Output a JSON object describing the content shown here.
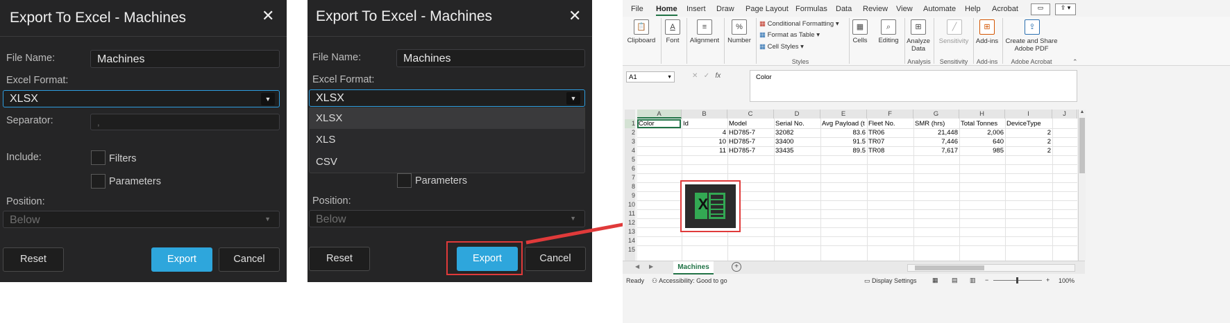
{
  "dialog1": {
    "title": "Export To Excel - Machines",
    "close": "✕",
    "file_name_label": "File Name:",
    "file_name_value": "Machines",
    "excel_format_label": "Excel Format:",
    "excel_format_value": "XLSX",
    "dropdown_arrow": "▼",
    "separator_label": "Separator:",
    "separator_value": ",",
    "include_label": "Include:",
    "filters_label": "Filters",
    "parameters_label": "Parameters",
    "position_label": "Position:",
    "position_value": "Below",
    "reset_label": "Reset",
    "export_label": "Export",
    "cancel_label": "Cancel"
  },
  "dialog2": {
    "title": "Export To Excel - Machines",
    "close": "✕",
    "file_name_label": "File Name:",
    "file_name_value": "Machines",
    "excel_format_label": "Excel Format:",
    "excel_format_value": "XLSX",
    "dropdown_arrow": "▼",
    "format_options": [
      "XLSX",
      "XLS",
      "CSV"
    ],
    "parameters_label": "Parameters",
    "position_label": "Position:",
    "position_value": "Below",
    "reset_label": "Reset",
    "export_label": "Export",
    "cancel_label": "Cancel",
    "highlight_color": "#e03a3a"
  },
  "excel": {
    "menu_tabs": [
      "File",
      "Home",
      "Insert",
      "Draw",
      "Page Layout",
      "Formulas",
      "Data",
      "Review",
      "View",
      "Automate",
      "Help",
      "Acrobat"
    ],
    "ribbon": {
      "clipboard": "Clipboard",
      "font": "Font",
      "alignment": "Alignment",
      "number": "Number",
      "conditional_formatting": "Conditional Formatting",
      "format_as_table": "Format as Table",
      "cell_styles": "Cell Styles",
      "styles_group": "Styles",
      "cells": "Cells",
      "editing": "Editing",
      "analyze_data_1": "Analyze",
      "analyze_data_2": "Data",
      "analysis_group": "Analysis",
      "sensitivity": "Sensitivity",
      "sensitivity_group": "Sensitivity",
      "addins": "Add-ins",
      "addins_group": "Add-ins",
      "create_share_1": "Create and Share",
      "create_share_2": "Adobe PDF",
      "adobe_group": "Adobe Acrobat"
    },
    "name_box": "A1",
    "formula_value": "Color",
    "fx": "fx",
    "columns": [
      "A",
      "B",
      "C",
      "D",
      "E",
      "F",
      "G",
      "H",
      "I",
      "J"
    ],
    "headers": [
      "Color",
      "Id",
      "Model",
      "Serial No.",
      "Avg Payload (t",
      "Fleet No.",
      "SMR (hrs)",
      "Total Tonnes",
      "DeviceType"
    ],
    "rows": [
      [
        "",
        "4",
        "HD785-7",
        "32082",
        "83.6",
        "TR06",
        "21,448",
        "2,006",
        "2"
      ],
      [
        "",
        "10",
        "HD785-7",
        "33400",
        "91.5",
        "TR07",
        "7,446",
        "640",
        "2"
      ],
      [
        "",
        "11",
        "HD785-7",
        "33435",
        "89.5",
        "TR08",
        "7,617",
        "985",
        "2"
      ]
    ],
    "row_numbers": [
      "1",
      "2",
      "3",
      "4",
      "5",
      "6",
      "7",
      "8",
      "9",
      "10",
      "11",
      "12",
      "13",
      "14",
      "15"
    ],
    "sheet_tab": "Machines",
    "status_ready": "Ready",
    "accessibility": "Accessibility: Good to go",
    "display_settings": "Display Settings",
    "zoom": "100%",
    "excel_logo_letter": "X",
    "excel_green": "#217346",
    "highlight_color": "#e03a3a"
  }
}
